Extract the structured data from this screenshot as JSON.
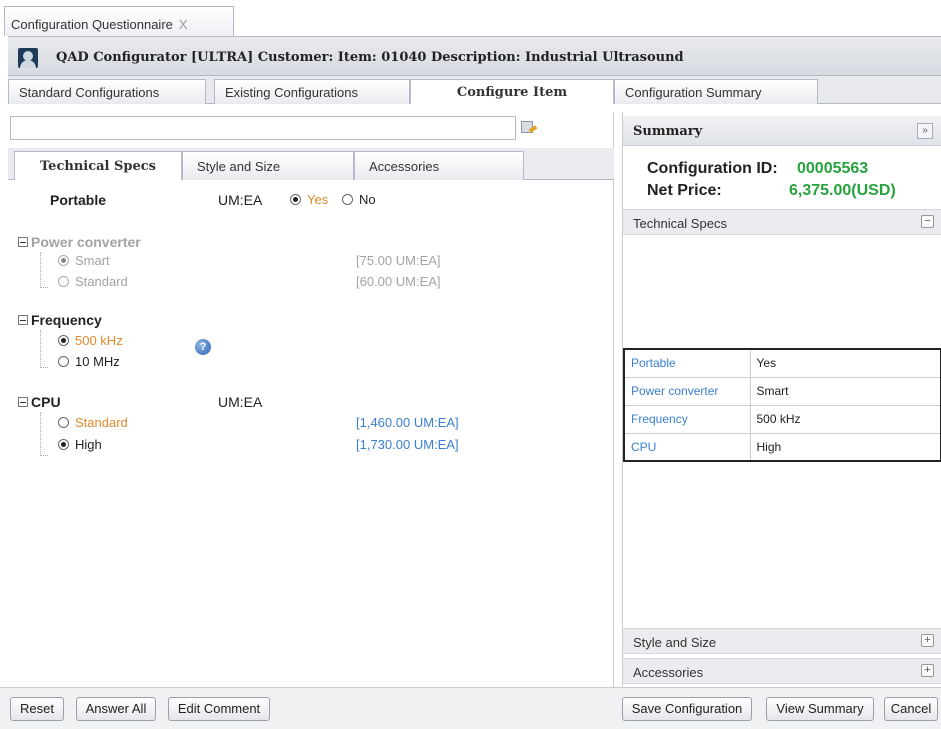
{
  "window_tab": {
    "label": "Configuration Questionnaire",
    "close": "X"
  },
  "title": "QAD Configurator [ULTRA] Customer: Item: 01040 Description: Industrial Ultrasound",
  "main_tabs": [
    {
      "label": "Standard Configurations"
    },
    {
      "label": "Existing Configurations"
    },
    {
      "label": "Configure Item"
    },
    {
      "label": "Configuration Summary"
    }
  ],
  "search": {
    "value": ""
  },
  "sub_tabs": [
    {
      "label": "Technical Specs"
    },
    {
      "label": "Style and Size"
    },
    {
      "label": "Accessories"
    }
  ],
  "questions": {
    "portable": {
      "label": "Portable",
      "uom": "UM:EA",
      "yes": "Yes",
      "no": "No",
      "selected": "Yes"
    },
    "power_converter": {
      "label": "Power converter",
      "help": "?",
      "options": [
        {
          "label": "Smart",
          "price": "[75.00 UM:EA]",
          "selected": true
        },
        {
          "label": "Standard",
          "price": "[60.00 UM:EA]",
          "selected": false
        }
      ]
    },
    "frequency": {
      "label": "Frequency",
      "options": [
        {
          "label": "500 kHz",
          "selected": true
        },
        {
          "label": "10 MHz",
          "selected": false
        }
      ]
    },
    "cpu": {
      "label": "CPU",
      "uom": "UM:EA",
      "options": [
        {
          "label": "Standard",
          "price": "[1,460.00 UM:EA]",
          "selected": false
        },
        {
          "label": "High",
          "price": "[1,730.00 UM:EA]",
          "selected": true
        }
      ]
    }
  },
  "summary": {
    "title": "Summary",
    "toggle": "»",
    "config_id_label": "Configuration ID:",
    "config_id": "00005563",
    "net_price_label": "Net Price:",
    "net_price": "6,375.00(USD)",
    "sections": [
      {
        "label": "Technical Specs",
        "toggle": "−"
      },
      {
        "label": "Style and Size",
        "toggle": "+"
      },
      {
        "label": "Accessories",
        "toggle": "+"
      }
    ],
    "specs": [
      {
        "key": "Portable",
        "value": "Yes"
      },
      {
        "key": "Power converter",
        "value": "Smart"
      },
      {
        "key": "Frequency",
        "value": "500 kHz"
      },
      {
        "key": "CPU",
        "value": "High"
      }
    ]
  },
  "buttons": {
    "reset": "Reset",
    "answer_all": "Answer All",
    "edit_comment": "Edit Comment",
    "save_configuration": "Save Configuration",
    "view_summary": "View Summary",
    "cancel": "Cancel"
  },
  "colors": {
    "green": "#27a33e",
    "orange": "#e08a2c",
    "blue": "#3a7fd0"
  }
}
